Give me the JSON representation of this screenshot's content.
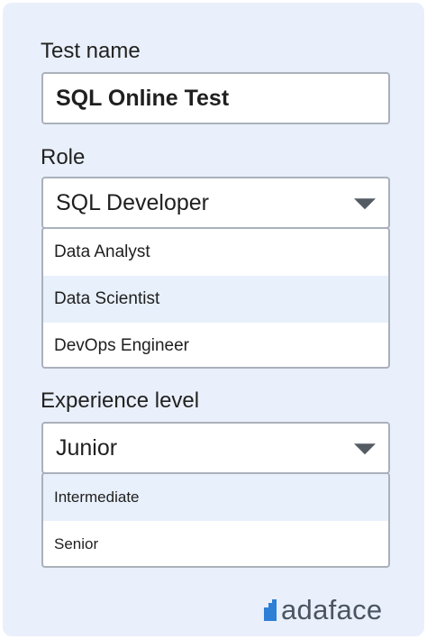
{
  "test_name": {
    "label": "Test name",
    "value": "SQL Online Test"
  },
  "role": {
    "label": "Role",
    "selected": "SQL Developer",
    "options": [
      "Data Analyst",
      "Data Scientist",
      "DevOps Engineer"
    ],
    "highlighted_option": "Data Scientist"
  },
  "experience": {
    "label": "Experience level",
    "selected": "Junior",
    "options": [
      "Intermediate",
      "Senior"
    ],
    "highlighted_option": "Intermediate"
  },
  "brand": {
    "name": "adaface",
    "accent_color": "#2e7fd6"
  },
  "icons": {
    "dropdown": "chevron-down-icon",
    "logo": "adaface-logo-icon"
  }
}
